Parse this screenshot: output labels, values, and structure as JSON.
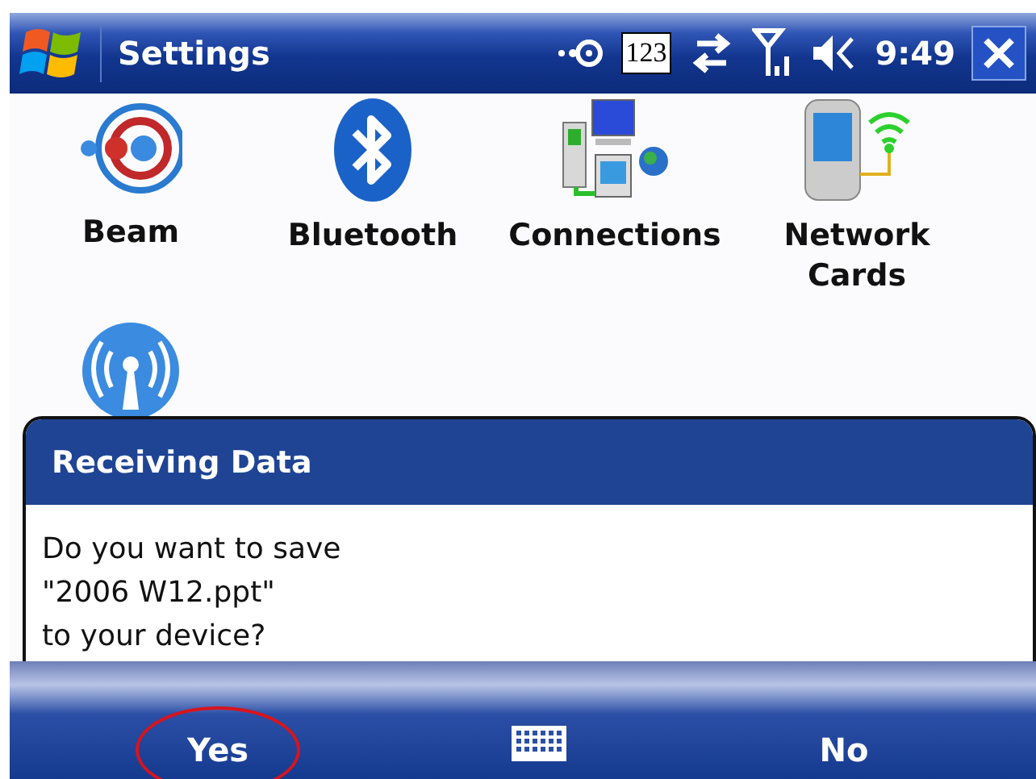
{
  "title_bar": {
    "title": "Settings",
    "input_mode": "123",
    "time": "9:49"
  },
  "settings_items": [
    {
      "kind": "beam",
      "label": "Beam"
    },
    {
      "kind": "bluetooth",
      "label": "Bluetooth"
    },
    {
      "kind": "connections",
      "label": "Connections"
    },
    {
      "kind": "network",
      "label": "Network Cards"
    },
    {
      "kind": "wireless"
    }
  ],
  "dialog": {
    "title": "Receiving Data",
    "message_lines": [
      "Do you want to save",
      "\"2006 W12.ppt\"",
      "to your device?"
    ]
  },
  "menu_bar": {
    "softkeys": [
      {
        "label": "Yes",
        "highlighted": true
      },
      {
        "label": "No",
        "highlighted": false
      }
    ]
  }
}
